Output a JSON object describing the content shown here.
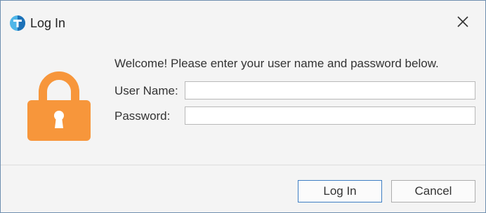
{
  "window": {
    "title": "Log In",
    "app_icon": "app-logo-icon",
    "close_icon": "close-icon"
  },
  "form": {
    "welcome": "Welcome! Please enter your user name and password below.",
    "username_label": "User Name:",
    "username_value": "",
    "password_label": "Password:",
    "password_value": "",
    "lock_icon": "lock-icon"
  },
  "buttons": {
    "login_label": "Log In",
    "cancel_label": "Cancel"
  },
  "colors": {
    "lock": "#F7963B",
    "app_icon_light": "#4FB6E8",
    "app_icon_dark": "#1D72B8",
    "default_button_border": "#3F7FC4"
  }
}
